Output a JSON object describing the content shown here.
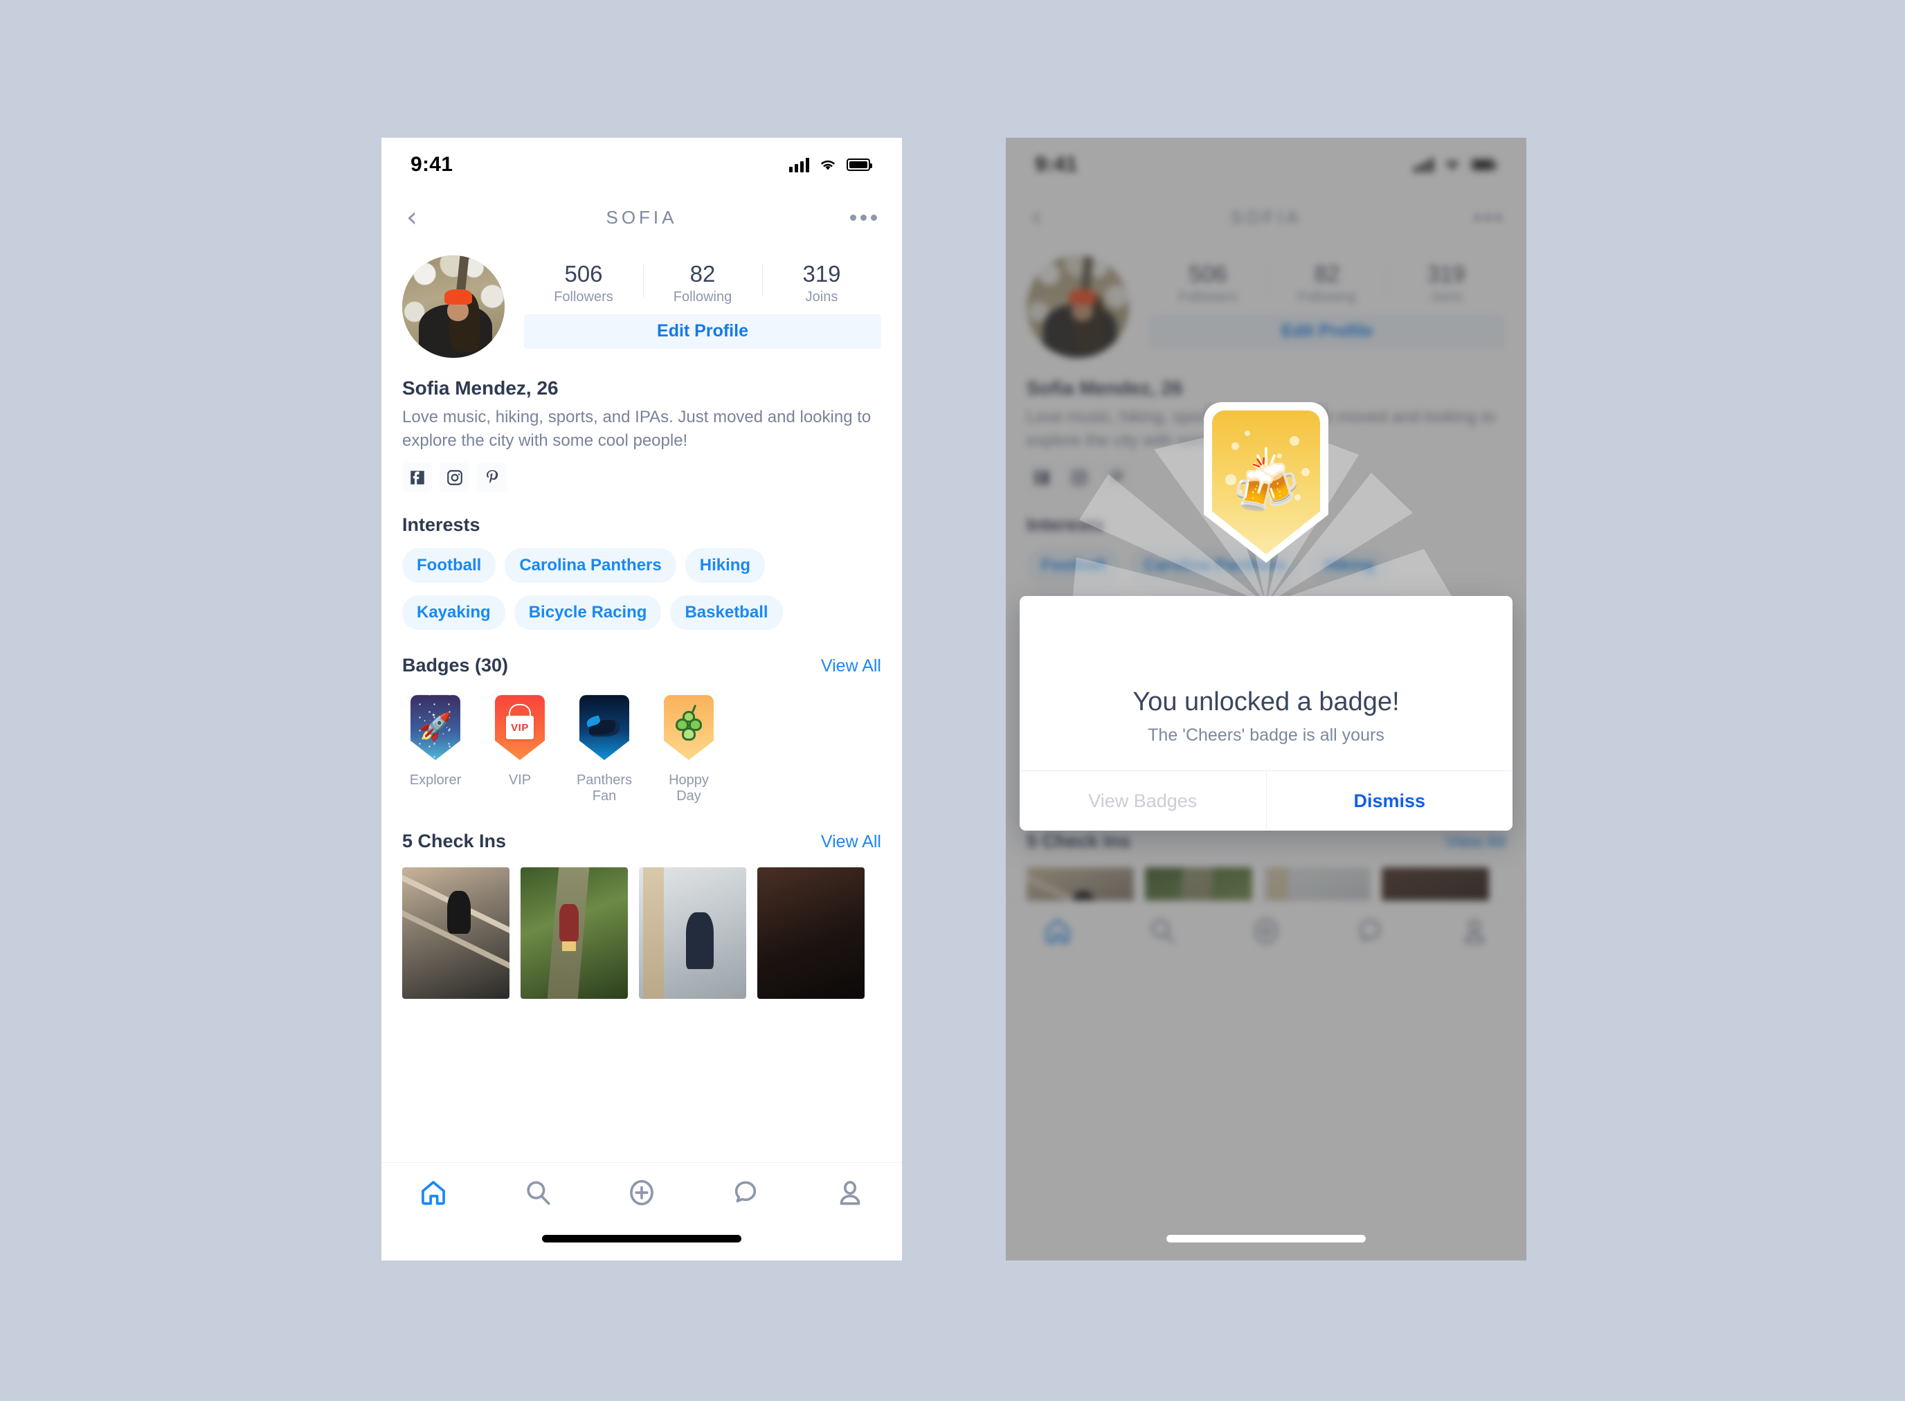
{
  "background_color": "#c7cfdd",
  "accent_blue": "#1a88f2",
  "phones": {
    "left_label": "profile-screen",
    "right_label": "profile-screen-with-badge-modal"
  },
  "status_bar": {
    "time": "9:41",
    "signal_icon": "cellular-signal-icon",
    "wifi_icon": "wifi-icon",
    "battery_icon": "battery-icon"
  },
  "nav": {
    "back_icon": "chevron-left-icon",
    "title": "SOFIA",
    "more_icon": "more-options-icon"
  },
  "profile": {
    "avatar_alt": "user-avatar",
    "stats": [
      {
        "value": "506",
        "label": "Followers"
      },
      {
        "value": "82",
        "label": "Following"
      },
      {
        "value": "319",
        "label": "Joins"
      }
    ],
    "edit_button": "Edit Profile",
    "name": "Sofia Mendez, 26",
    "bio": "Love music, hiking, sports, and IPAs. Just moved and looking to explore the city with some cool people!",
    "socials": [
      {
        "name": "facebook-icon"
      },
      {
        "name": "instagram-icon"
      },
      {
        "name": "pinterest-icon"
      }
    ]
  },
  "interests": {
    "title": "Interests",
    "items": [
      "Football",
      "Carolina Panthers",
      "Hiking",
      "Kayaking",
      "Bicycle Racing",
      "Basketball"
    ]
  },
  "badges": {
    "title": "Badges (30)",
    "view_all": "View All",
    "items": [
      {
        "label": "Explorer",
        "icon": "rocket-badge-icon"
      },
      {
        "label": "VIP",
        "icon": "vip-pass-badge-icon",
        "card_text": "VIP"
      },
      {
        "label": "Panthers Fan",
        "icon": "panther-badge-icon"
      },
      {
        "label": "Hoppy Day",
        "icon": "hops-badge-icon"
      }
    ]
  },
  "checkins": {
    "title": "5 Check Ins",
    "view_all": "View All",
    "items": [
      {
        "alt": "friends-on-railroad-tracks-photo"
      },
      {
        "alt": "person-with-backpack-on-bridge-photo"
      },
      {
        "alt": "person-walking-city-sidewalk-photo"
      },
      {
        "alt": "dark-portrait-photo"
      }
    ]
  },
  "tabbar": {
    "items": [
      {
        "name": "home-icon",
        "active": true
      },
      {
        "name": "search-icon",
        "active": false
      },
      {
        "name": "add-plus-icon",
        "active": false
      },
      {
        "name": "chat-bubble-icon",
        "active": false
      },
      {
        "name": "profile-person-icon",
        "active": false
      }
    ]
  },
  "modal": {
    "badge_icon": "cheers-beer-badge-icon",
    "badge_emoji": "🍻",
    "title": "You unlocked a badge!",
    "subtitle": "The 'Cheers' badge is all yours",
    "secondary_button": "View Badges",
    "primary_button": "Dismiss"
  }
}
